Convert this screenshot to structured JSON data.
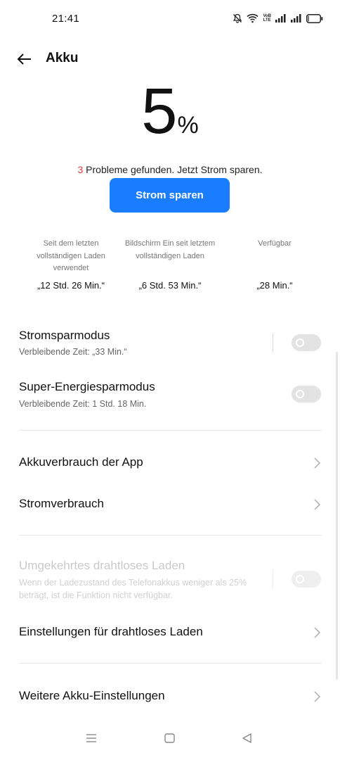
{
  "status_bar": {
    "time": "21:41",
    "volte_top": "VoB",
    "volte_bottom": "LTE",
    "icons": [
      "bell-off-icon",
      "wifi-icon",
      "volte-icon",
      "signal-icon",
      "signal-icon",
      "battery-icon"
    ]
  },
  "header": {
    "title": "Akku"
  },
  "battery": {
    "value": "5",
    "unit": "%",
    "level_fraction": 0.05
  },
  "problems": {
    "count": "3",
    "text": " Probleme gefunden. Jetzt Strom sparen."
  },
  "save_button": {
    "label": "Strom sparen"
  },
  "stats": [
    {
      "label": "Seit dem letzten vollständigen Laden verwendet",
      "value": "„12 Std. 26 Min.“"
    },
    {
      "label": "Bildschirm Ein seit letztem vollständigen Laden",
      "value": "„6 Std. 53 Min.“"
    },
    {
      "label": "Verfügbar",
      "value": "„28 Min.“"
    }
  ],
  "settings": {
    "power_saving": {
      "title": "Stromsparmodus",
      "subtitle": "Verbleibende Zeit:  „33 Min.“",
      "enabled": false
    },
    "super_power_saving": {
      "title": "Super-Energiesparmodus",
      "subtitle": "Verbleibende Zeit:  1 Std. 18 Min.",
      "enabled": false
    },
    "app_usage": {
      "title": "Akkuverbrauch der App"
    },
    "power_consumption": {
      "title": "Stromverbrauch"
    },
    "reverse_wireless": {
      "title": "Umgekehrtes drahtloses Laden",
      "subtitle": "Wenn der Ladezustand des Telefonakkus weniger als 25% beträgt, ist die Funktion nicht verfügbar.",
      "enabled": false,
      "disabled": true
    },
    "wireless_settings": {
      "title": "Einstellungen für drahtloses Laden"
    },
    "more_settings": {
      "title": "Weitere Akku-Einstellungen"
    }
  },
  "colors": {
    "accent": "#1a7dff",
    "problem_count": "#e0383a",
    "toggle_off": "#e3e3e3"
  }
}
